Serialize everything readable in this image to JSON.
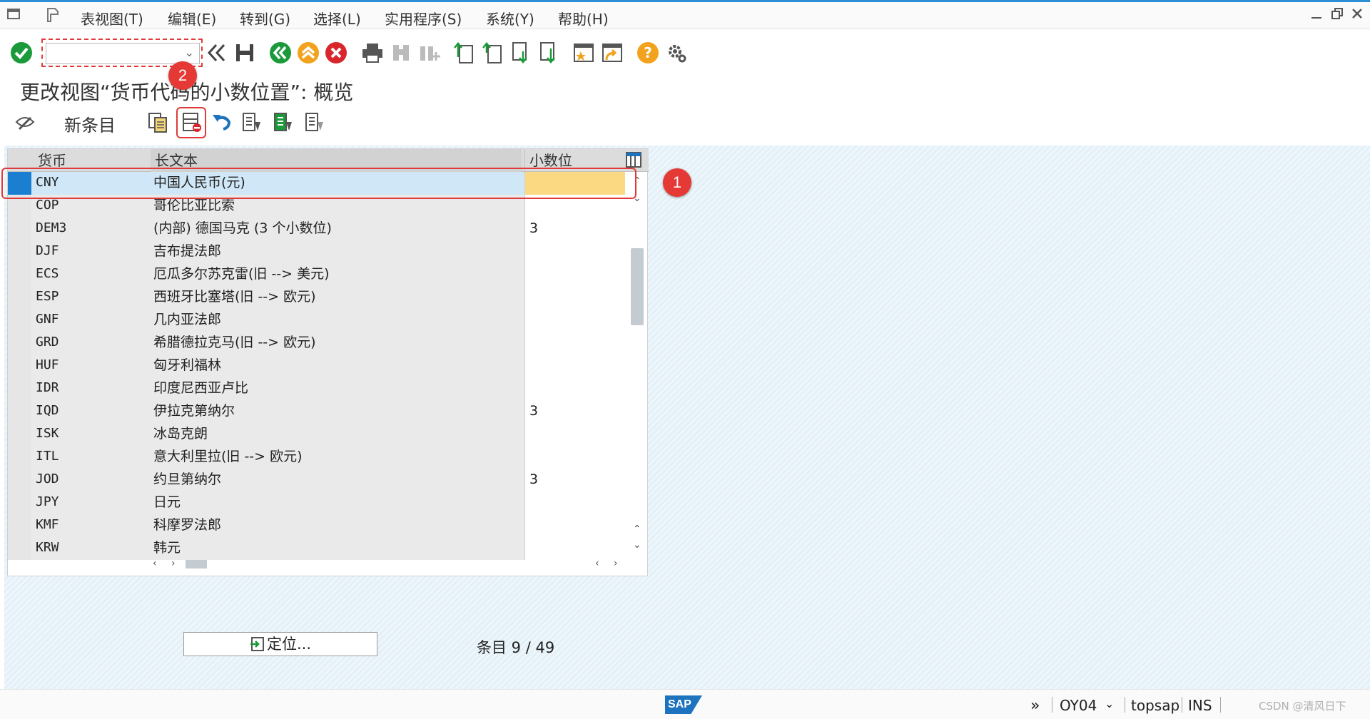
{
  "menu": {
    "items": [
      "表视图(T)",
      "编辑(E)",
      "转到(G)",
      "选择(L)",
      "实用程序(S)",
      "系统(Y)",
      "帮助(H)"
    ]
  },
  "toolbar": {
    "command_value": "",
    "icons": [
      "enter-check",
      "command-field",
      "back-double",
      "save",
      "back",
      "exit",
      "cancel",
      "print",
      "find",
      "find-next",
      "first-page",
      "previous-page",
      "next-page",
      "last-page",
      "create-session",
      "shortcut",
      "help",
      "customize"
    ]
  },
  "page": {
    "title": "更改视图“货币代码的小数位置”: 概览"
  },
  "app_toolbar": {
    "new_entries_label": "新条目"
  },
  "table": {
    "headers": [
      "货币",
      "长文本",
      "小数位"
    ],
    "rows": [
      {
        "currency": "CNY",
        "text": "中国人民币(元)",
        "decimals": "",
        "selected": true
      },
      {
        "currency": "COP",
        "text": "哥伦比亚比索",
        "decimals": ""
      },
      {
        "currency": "DEM3",
        "text": "(内部) 德国马克 (3 个小数位)",
        "decimals": "3"
      },
      {
        "currency": "DJF",
        "text": "吉布提法郎",
        "decimals": ""
      },
      {
        "currency": "ECS",
        "text": "厄瓜多尔苏克雷(旧 --> 美元)",
        "decimals": ""
      },
      {
        "currency": "ESP",
        "text": "西班牙比塞塔(旧 --> 欧元)",
        "decimals": ""
      },
      {
        "currency": "GNF",
        "text": "几内亚法郎",
        "decimals": ""
      },
      {
        "currency": "GRD",
        "text": "希腊德拉克马(旧 --> 欧元)",
        "decimals": ""
      },
      {
        "currency": "HUF",
        "text": "匈牙利福林",
        "decimals": ""
      },
      {
        "currency": "IDR",
        "text": "印度尼西亚卢比",
        "decimals": ""
      },
      {
        "currency": "IQD",
        "text": "伊拉克第纳尔",
        "decimals": "3"
      },
      {
        "currency": "ISK",
        "text": "冰岛克朗",
        "decimals": ""
      },
      {
        "currency": "ITL",
        "text": "意大利里拉(旧 --> 欧元)",
        "decimals": ""
      },
      {
        "currency": "JOD",
        "text": "约旦第纳尔",
        "decimals": "3"
      },
      {
        "currency": "JPY",
        "text": "日元",
        "decimals": ""
      },
      {
        "currency": "KMF",
        "text": "科摩罗法郎",
        "decimals": ""
      },
      {
        "currency": "KRW",
        "text": "韩元",
        "decimals": ""
      }
    ]
  },
  "annotations": {
    "badge_1": "1",
    "badge_2": "2"
  },
  "footer": {
    "locate_label": "定位...",
    "entry_info": "条目 9 / 49"
  },
  "statusbar": {
    "brand": "SAP",
    "transaction": "OY04",
    "server": "topsap",
    "mode": "INS",
    "watermark": "CSDN @清风日下"
  },
  "colors": {
    "accent": "#2b8fd6",
    "selected_row": "#cfe7f7",
    "selected_cell": "#fbd983",
    "highlight_red": "#e03a3a"
  }
}
